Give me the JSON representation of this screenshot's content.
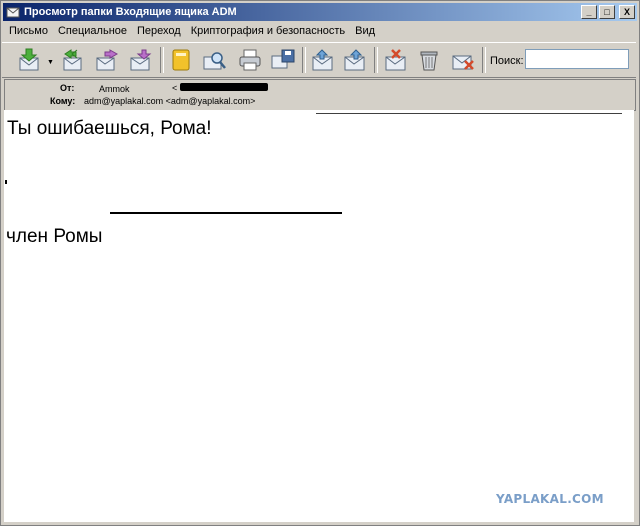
{
  "window": {
    "title": "Просмотр папки Входящие ящика ADM",
    "min_label": "_",
    "max_label": "□",
    "close_label": "X"
  },
  "menu": {
    "items": [
      {
        "label": "Письмо"
      },
      {
        "label": "Специальное"
      },
      {
        "label": "Переход"
      },
      {
        "label": "Криптография и безопасность"
      },
      {
        "label": "Вид"
      }
    ]
  },
  "toolbar": {
    "dropdown_glyph": "▼",
    "buttons": [
      {
        "icon": "get-mail-icon"
      },
      {
        "icon": "reply-all-icon"
      },
      {
        "icon": "forward-icon"
      },
      {
        "icon": "new-message-icon"
      },
      {
        "icon": "address-book-icon"
      },
      {
        "icon": "find-icon"
      },
      {
        "icon": "print-icon"
      },
      {
        "icon": "save-icon"
      },
      {
        "icon": "previous-message-icon"
      },
      {
        "icon": "next-message-icon"
      },
      {
        "icon": "junk-icon"
      },
      {
        "icon": "trash-icon"
      },
      {
        "icon": "delete-icon"
      }
    ],
    "search_label": "Поиск:",
    "search_value": ""
  },
  "headers": {
    "from_label": "От:",
    "from_name": "Ammok",
    "from_email_open": "<",
    "to_label": "Кому:",
    "to_value": "adm@yaplakal.com <adm@yaplakal.com>"
  },
  "message": {
    "line1": "Ты ошибаешься, Рома!",
    "line2": "член Ромы"
  },
  "watermark": "YAPLAKAL.COM",
  "colors": {
    "titlebar_start": "#0a246a",
    "titlebar_end": "#a6caf0",
    "window_bg": "#d4d0c8",
    "watermark": "#7a9ec8"
  }
}
